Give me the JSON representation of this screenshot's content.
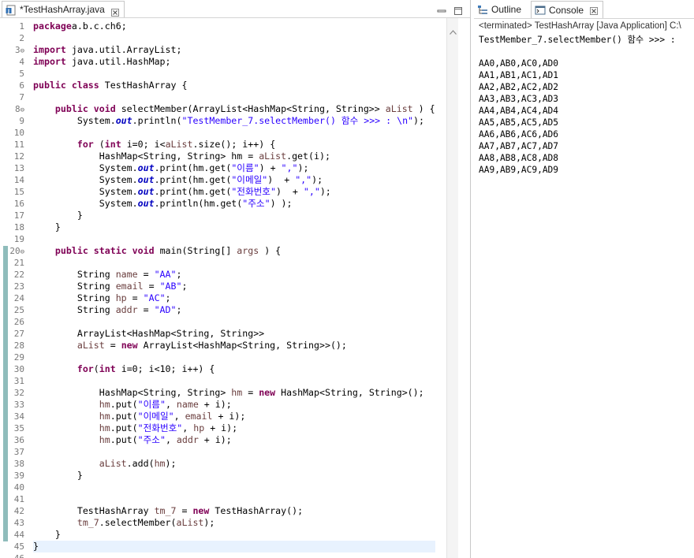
{
  "editor": {
    "tab_title": "*TestHashArray.java",
    "line_numbers": [
      "1",
      "2",
      "3",
      "4",
      "5",
      "6",
      "7",
      "8",
      "9",
      "10",
      "11",
      "12",
      "13",
      "14",
      "15",
      "16",
      "17",
      "18",
      "19",
      "20",
      "21",
      "22",
      "23",
      "24",
      "25",
      "26",
      "27",
      "28",
      "29",
      "30",
      "31",
      "32",
      "33",
      "34",
      "35",
      "36",
      "37",
      "38",
      "39",
      "40",
      "41",
      "42",
      "43",
      "44",
      "45",
      "46"
    ],
    "code_lines": [
      [
        [
          "kw",
          "package"
        ],
        [
          "",
          "a.b.c.ch6;"
        ]
      ],
      [],
      [
        [
          "kw",
          "import"
        ],
        [
          "",
          " java.util.ArrayList;"
        ]
      ],
      [
        [
          "kw",
          "import"
        ],
        [
          "",
          " java.util.HashMap;"
        ]
      ],
      [],
      [
        [
          "kw",
          "public"
        ],
        [
          "",
          ""
        ],
        [
          "kw",
          " class"
        ],
        [
          "",
          " TestHashArray {"
        ]
      ],
      [],
      [
        [
          "",
          "    "
        ],
        [
          "kw",
          "public"
        ],
        [
          "kw",
          " void"
        ],
        [
          "",
          " selectMember(ArrayList<HashMap<String, String>> "
        ],
        [
          "var",
          "aList"
        ],
        [
          "",
          " ) {"
        ]
      ],
      [
        [
          "",
          "        System."
        ],
        [
          "fld",
          "out"
        ],
        [
          "",
          ".println("
        ],
        [
          "str",
          "\"TestMember_7.selectMember() 함수 >>> : \\n\""
        ],
        [
          "",
          ");"
        ]
      ],
      [],
      [
        [
          "",
          "        "
        ],
        [
          "kw",
          "for"
        ],
        [
          "",
          " ("
        ],
        [
          "kw",
          "int"
        ],
        [
          "",
          " i=0; i<"
        ],
        [
          "var",
          "aList"
        ],
        [
          "",
          ".size(); i++) {"
        ]
      ],
      [
        [
          "",
          "            HashMap<String, String> hm = "
        ],
        [
          "var",
          "aList"
        ],
        [
          "",
          ".get(i);"
        ]
      ],
      [
        [
          "",
          "            System."
        ],
        [
          "fld",
          "out"
        ],
        [
          "",
          ".print(hm.get("
        ],
        [
          "str",
          "\"이름\""
        ],
        [
          "",
          ") + "
        ],
        [
          "str",
          "\",\""
        ],
        [
          "",
          ");"
        ]
      ],
      [
        [
          "",
          "            System."
        ],
        [
          "fld",
          "out"
        ],
        [
          "",
          ".print(hm.get("
        ],
        [
          "str",
          "\"이메일\""
        ],
        [
          "",
          ")  + "
        ],
        [
          "str",
          "\",\""
        ],
        [
          "",
          ");"
        ]
      ],
      [
        [
          "",
          "            System."
        ],
        [
          "fld",
          "out"
        ],
        [
          "",
          ".print(hm.get("
        ],
        [
          "str",
          "\"전화번호\""
        ],
        [
          "",
          ")  + "
        ],
        [
          "str",
          "\",\""
        ],
        [
          "",
          ");"
        ]
      ],
      [
        [
          "",
          "            System."
        ],
        [
          "fld",
          "out"
        ],
        [
          "",
          ".println(hm.get("
        ],
        [
          "str",
          "\"주소\""
        ],
        [
          "",
          ") );"
        ]
      ],
      [
        [
          "",
          "        }"
        ]
      ],
      [
        [
          "",
          "    }"
        ]
      ],
      [],
      [
        [
          "",
          "    "
        ],
        [
          "kw",
          "public"
        ],
        [
          "kw",
          " static"
        ],
        [
          "kw",
          " void"
        ],
        [
          "",
          " main(String[] "
        ],
        [
          "var",
          "args"
        ],
        [
          "",
          " ) {"
        ]
      ],
      [],
      [
        [
          "",
          "        String "
        ],
        [
          "var",
          "name"
        ],
        [
          "",
          " = "
        ],
        [
          "str",
          "\"AA\""
        ],
        [
          "",
          ";"
        ]
      ],
      [
        [
          "",
          "        String "
        ],
        [
          "var",
          "email"
        ],
        [
          "",
          " = "
        ],
        [
          "str",
          "\"AB\""
        ],
        [
          "",
          ";"
        ]
      ],
      [
        [
          "",
          "        String "
        ],
        [
          "var",
          "hp"
        ],
        [
          "",
          " = "
        ],
        [
          "str",
          "\"AC\""
        ],
        [
          "",
          ";"
        ]
      ],
      [
        [
          "",
          "        String "
        ],
        [
          "var",
          "addr"
        ],
        [
          "",
          " = "
        ],
        [
          "str",
          "\"AD\""
        ],
        [
          "",
          ";"
        ]
      ],
      [],
      [
        [
          "",
          "        ArrayList<HashMap<String, String>>"
        ]
      ],
      [
        [
          "",
          "        "
        ],
        [
          "var",
          "aList"
        ],
        [
          "",
          " = "
        ],
        [
          "kw",
          "new"
        ],
        [
          "",
          " ArrayList<HashMap<String, String>>();"
        ]
      ],
      [],
      [
        [
          "",
          "        "
        ],
        [
          "kw",
          "for"
        ],
        [
          "",
          "("
        ],
        [
          "kw",
          "int"
        ],
        [
          "",
          " i=0; i<10; i++) {"
        ]
      ],
      [],
      [
        [
          "",
          "            HashMap<String, String> "
        ],
        [
          "var",
          "hm"
        ],
        [
          "",
          " = "
        ],
        [
          "kw",
          "new"
        ],
        [
          "",
          " HashMap<String, String>();"
        ]
      ],
      [
        [
          "",
          "            "
        ],
        [
          "var",
          "hm"
        ],
        [
          "",
          ".put("
        ],
        [
          "str",
          "\"이름\""
        ],
        [
          "",
          ", "
        ],
        [
          "var",
          "name"
        ],
        [
          "",
          " + i);"
        ]
      ],
      [
        [
          "",
          "            "
        ],
        [
          "var",
          "hm"
        ],
        [
          "",
          ".put("
        ],
        [
          "str",
          "\"이메일\""
        ],
        [
          "",
          ", "
        ],
        [
          "var",
          "email"
        ],
        [
          "",
          " + i);"
        ]
      ],
      [
        [
          "",
          "            "
        ],
        [
          "var",
          "hm"
        ],
        [
          "",
          ".put("
        ],
        [
          "str",
          "\"전화번호\""
        ],
        [
          "",
          ", "
        ],
        [
          "var",
          "hp"
        ],
        [
          "",
          " + i);"
        ]
      ],
      [
        [
          "",
          "            "
        ],
        [
          "var",
          "hm"
        ],
        [
          "",
          ".put("
        ],
        [
          "str",
          "\"주소\""
        ],
        [
          "",
          ", "
        ],
        [
          "var",
          "addr"
        ],
        [
          "",
          " + i);"
        ]
      ],
      [],
      [
        [
          "",
          "            "
        ],
        [
          "var",
          "aList"
        ],
        [
          "",
          ".add("
        ],
        [
          "var",
          "hm"
        ],
        [
          "",
          ");"
        ]
      ],
      [
        [
          "",
          "        }"
        ]
      ],
      [],
      [],
      [
        [
          "",
          "        TestHashArray "
        ],
        [
          "var",
          "tm_7"
        ],
        [
          "",
          " = "
        ],
        [
          "kw",
          "new"
        ],
        [
          "",
          " TestHashArray();"
        ]
      ],
      [
        [
          "",
          "        "
        ],
        [
          "var",
          "tm_7"
        ],
        [
          "",
          ".selectMember("
        ],
        [
          "var",
          "aList"
        ],
        [
          "",
          ");"
        ]
      ],
      [
        [
          "",
          "    }"
        ]
      ],
      [
        [
          "",
          "}"
        ]
      ],
      []
    ]
  },
  "console": {
    "outline_tab": "Outline",
    "console_tab": "Console",
    "status": "<terminated> TestHashArray [Java Application] C:\\",
    "output_lines": [
      "TestMember_7.selectMember() 함수 >>> :",
      "",
      "AA0,AB0,AC0,AD0",
      "AA1,AB1,AC1,AD1",
      "AA2,AB2,AC2,AD2",
      "AA3,AB3,AC3,AD3",
      "AA4,AB4,AC4,AD4",
      "AA5,AB5,AC5,AD5",
      "AA6,AB6,AC6,AD6",
      "AA7,AB7,AC7,AD7",
      "AA8,AB8,AC8,AD8",
      "AA9,AB9,AC9,AD9"
    ]
  },
  "icons": {
    "java_file": "java-file-icon",
    "close": "close-icon",
    "minimize": "minimize-icon",
    "maximize": "maximize-icon",
    "outline": "outline-icon",
    "console": "console-icon",
    "scroll_up": "scroll-up-arrow-icon"
  },
  "colors": {
    "keyword": "#7f0055",
    "string": "#2a00ff",
    "static_field": "#0000c0",
    "local_var": "#6a3e3e",
    "change_bar": "#8fbcbb"
  }
}
